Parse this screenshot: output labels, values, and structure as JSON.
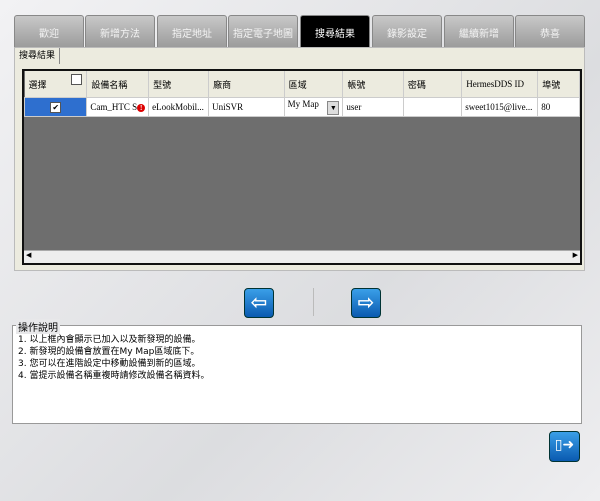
{
  "tabs": [
    {
      "label": "歡迎"
    },
    {
      "label": "新增方法"
    },
    {
      "label": "指定地址"
    },
    {
      "label": "指定電子地圖"
    },
    {
      "label": "搜尋結果",
      "active": true
    },
    {
      "label": "錄影設定"
    },
    {
      "label": "繼續新增"
    },
    {
      "label": "恭喜"
    }
  ],
  "subtab": "搜尋結果",
  "table": {
    "headers": [
      "選擇",
      "設備名稱",
      "型號",
      "廠商",
      "區域",
      "帳號",
      "密碼",
      "HermesDDS ID",
      "埠號"
    ],
    "select_all_checked": false,
    "rows": [
      {
        "checked": true,
        "name": "Cam_HTC S",
        "warning": true,
        "model": "eLookMobil...",
        "vendor": "UniSVR",
        "area": "My Map",
        "account": "user",
        "password": "",
        "hermes_id": "sweet1015@live...",
        "port": "80"
      }
    ]
  },
  "instructions": {
    "title": "操作說明",
    "lines": [
      "1. 以上框內會顯示已加入以及新發現的設備。",
      "2. 新發現的設備會放置在My Map區域底下。",
      "3. 您可以在進階設定中移動設備到新的區域。",
      "4. 當提示設備名稱重複時請修改設備名稱資料。"
    ]
  },
  "icons": {
    "back": "arrow-left-icon",
    "next": "arrow-right-icon",
    "exit": "exit-door-icon"
  },
  "colors": {
    "active_tab": "#000000",
    "selection": "#2e6fcf",
    "button": "#1a78d0"
  }
}
